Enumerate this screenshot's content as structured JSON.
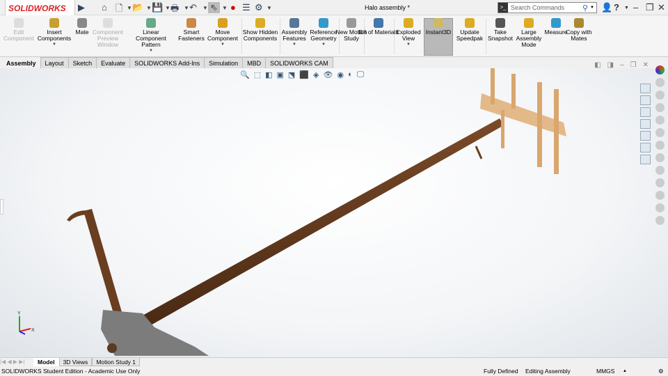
{
  "app": {
    "logo": "SOLIDWORKS",
    "document_title": "Halo assembly *"
  },
  "search": {
    "placeholder": "Search Commands"
  },
  "ribbon": [
    {
      "label": "Edit Component",
      "disabled": true,
      "color": "#ccc"
    },
    {
      "label": "Insert Components",
      "dropdown": true,
      "color": "#c8a030"
    },
    {
      "label": "Mate",
      "color": "#888"
    },
    {
      "label": "Component Preview Window",
      "disabled": true,
      "color": "#ccc"
    },
    {
      "label": "Linear Component Pattern",
      "dropdown": true,
      "color": "#6a8"
    },
    {
      "label": "Smart Fasteners",
      "color": "#c84"
    },
    {
      "label": "Move Component",
      "dropdown": true,
      "color": "#d9a020"
    },
    {
      "label": "Show Hidden Components",
      "color": "#da2"
    },
    {
      "label": "Assembly Features",
      "dropdown": true,
      "color": "#579"
    },
    {
      "label": "Reference Geometry",
      "dropdown": true,
      "color": "#39c"
    },
    {
      "label": "New Motion Study",
      "color": "#999"
    },
    {
      "label": "Bill of Materials",
      "color": "#47a"
    },
    {
      "label": "Exploded View",
      "dropdown": true,
      "color": "#da2"
    },
    {
      "label": "Instant3D",
      "active": true,
      "color": "#cb6"
    },
    {
      "label": "Update Speedpak",
      "color": "#da2"
    },
    {
      "label": "Take Snapshot",
      "color": "#555"
    },
    {
      "label": "Large Assembly Mode",
      "color": "#da2"
    },
    {
      "label": "Measure",
      "color": "#39c"
    },
    {
      "label": "Copy with Mates",
      "color": "#a83"
    }
  ],
  "tabs": [
    "Assembly",
    "Layout",
    "Sketch",
    "Evaluate",
    "SOLIDWORKS Add-Ins",
    "Simulation",
    "MBD",
    "SOLIDWORKS CAM"
  ],
  "bottom_tabs": [
    "Model",
    "3D Views",
    "Motion Study 1"
  ],
  "status": {
    "left": "SOLIDWORKS Student Edition - Academic Use Only",
    "state": "Fully Defined",
    "mode": "Editing Assembly",
    "units": "MMGS"
  },
  "triad": {
    "y": "Y",
    "x": "X"
  }
}
